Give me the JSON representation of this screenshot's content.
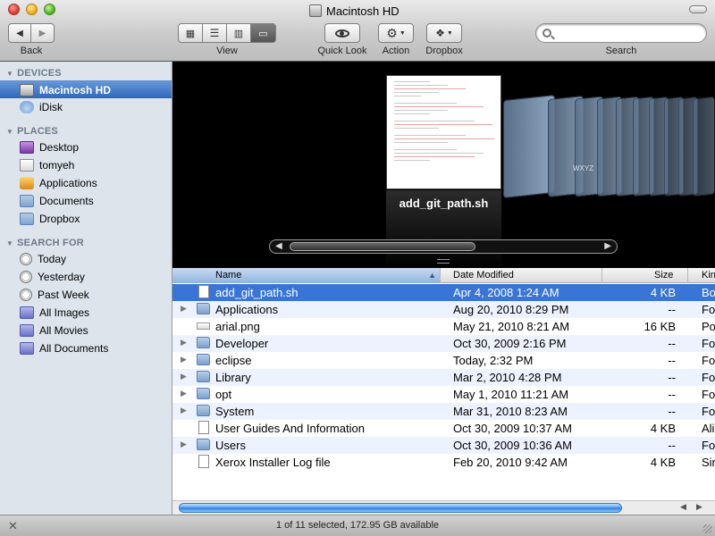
{
  "window": {
    "title": "Macintosh HD"
  },
  "toolbar": {
    "back_label": "Back",
    "view_label": "View",
    "quicklook_label": "Quick Look",
    "action_label": "Action",
    "dropbox_label": "Dropbox",
    "search_label": "Search",
    "search_value": "",
    "view_mode_selected": "cover-flow"
  },
  "sidebar": {
    "devices_header": "DEVICES",
    "devices": [
      {
        "label": "Macintosh HD",
        "icon": "hard-drive-icon",
        "selected": true
      },
      {
        "label": "iDisk",
        "icon": "idisk-icon"
      }
    ],
    "places_header": "PLACES",
    "places": [
      {
        "label": "Desktop",
        "icon": "desktop-icon"
      },
      {
        "label": "tomyeh",
        "icon": "home-icon"
      },
      {
        "label": "Applications",
        "icon": "applications-icon"
      },
      {
        "label": "Documents",
        "icon": "documents-folder-icon"
      },
      {
        "label": "Dropbox",
        "icon": "dropbox-folder-icon"
      }
    ],
    "search_header": "SEARCH FOR",
    "search_for": [
      {
        "label": "Today",
        "icon": "clock-icon"
      },
      {
        "label": "Yesterday",
        "icon": "clock-icon"
      },
      {
        "label": "Past Week",
        "icon": "clock-icon"
      },
      {
        "label": "All Images",
        "icon": "smart-folder-icon"
      },
      {
        "label": "All Movies",
        "icon": "smart-folder-icon"
      },
      {
        "label": "All Documents",
        "icon": "smart-folder-icon"
      }
    ]
  },
  "coverflow": {
    "caption": "add_git_path.sh",
    "badge": "WXYZ"
  },
  "list": {
    "columns": {
      "name": "Name",
      "date": "Date Modified",
      "size": "Size",
      "kind": "Kin"
    },
    "rows": [
      {
        "name": "add_git_path.sh",
        "date": "Apr 4, 2008 1:24 AM",
        "size": "4 KB",
        "kind": "Bo",
        "icon": "document-icon",
        "selected": true,
        "expandable": false
      },
      {
        "name": "Applications",
        "date": "Aug 20, 2010 8:29 PM",
        "size": "--",
        "kind": "Fol",
        "icon": "applications-folder-icon",
        "expandable": true
      },
      {
        "name": "arial.png",
        "date": "May 21, 2010 8:21 AM",
        "size": "16 KB",
        "kind": "Po",
        "icon": "image-file-icon",
        "expandable": false
      },
      {
        "name": "Developer",
        "date": "Oct 30, 2009 2:16 PM",
        "size": "--",
        "kind": "Fol",
        "icon": "folder-icon",
        "expandable": true
      },
      {
        "name": "eclipse",
        "date": "Today, 2:32 PM",
        "size": "--",
        "kind": "Fol",
        "icon": "folder-icon",
        "expandable": true
      },
      {
        "name": "Library",
        "date": "Mar 2, 2010 4:28 PM",
        "size": "--",
        "kind": "Fol",
        "icon": "library-folder-icon",
        "expandable": true
      },
      {
        "name": "opt",
        "date": "May 1, 2010 11:21 AM",
        "size": "--",
        "kind": "Fol",
        "icon": "folder-icon",
        "expandable": true
      },
      {
        "name": "System",
        "date": "Mar 31, 2010 8:23 AM",
        "size": "--",
        "kind": "Fol",
        "icon": "system-folder-icon",
        "expandable": true
      },
      {
        "name": "User Guides And Information",
        "date": "Oct 30, 2009 10:37 AM",
        "size": "4 KB",
        "kind": "Ali",
        "icon": "alias-icon",
        "expandable": false
      },
      {
        "name": "Users",
        "date": "Oct 30, 2009 10:36 AM",
        "size": "--",
        "kind": "Fol",
        "icon": "users-folder-icon",
        "expandable": true
      },
      {
        "name": "Xerox Installer Log file",
        "date": "Feb 20, 2010 9:42 AM",
        "size": "4 KB",
        "kind": "Sin",
        "icon": "document-icon",
        "expandable": false
      }
    ]
  },
  "status": {
    "text": "1 of 11 selected, 172.95 GB available"
  }
}
